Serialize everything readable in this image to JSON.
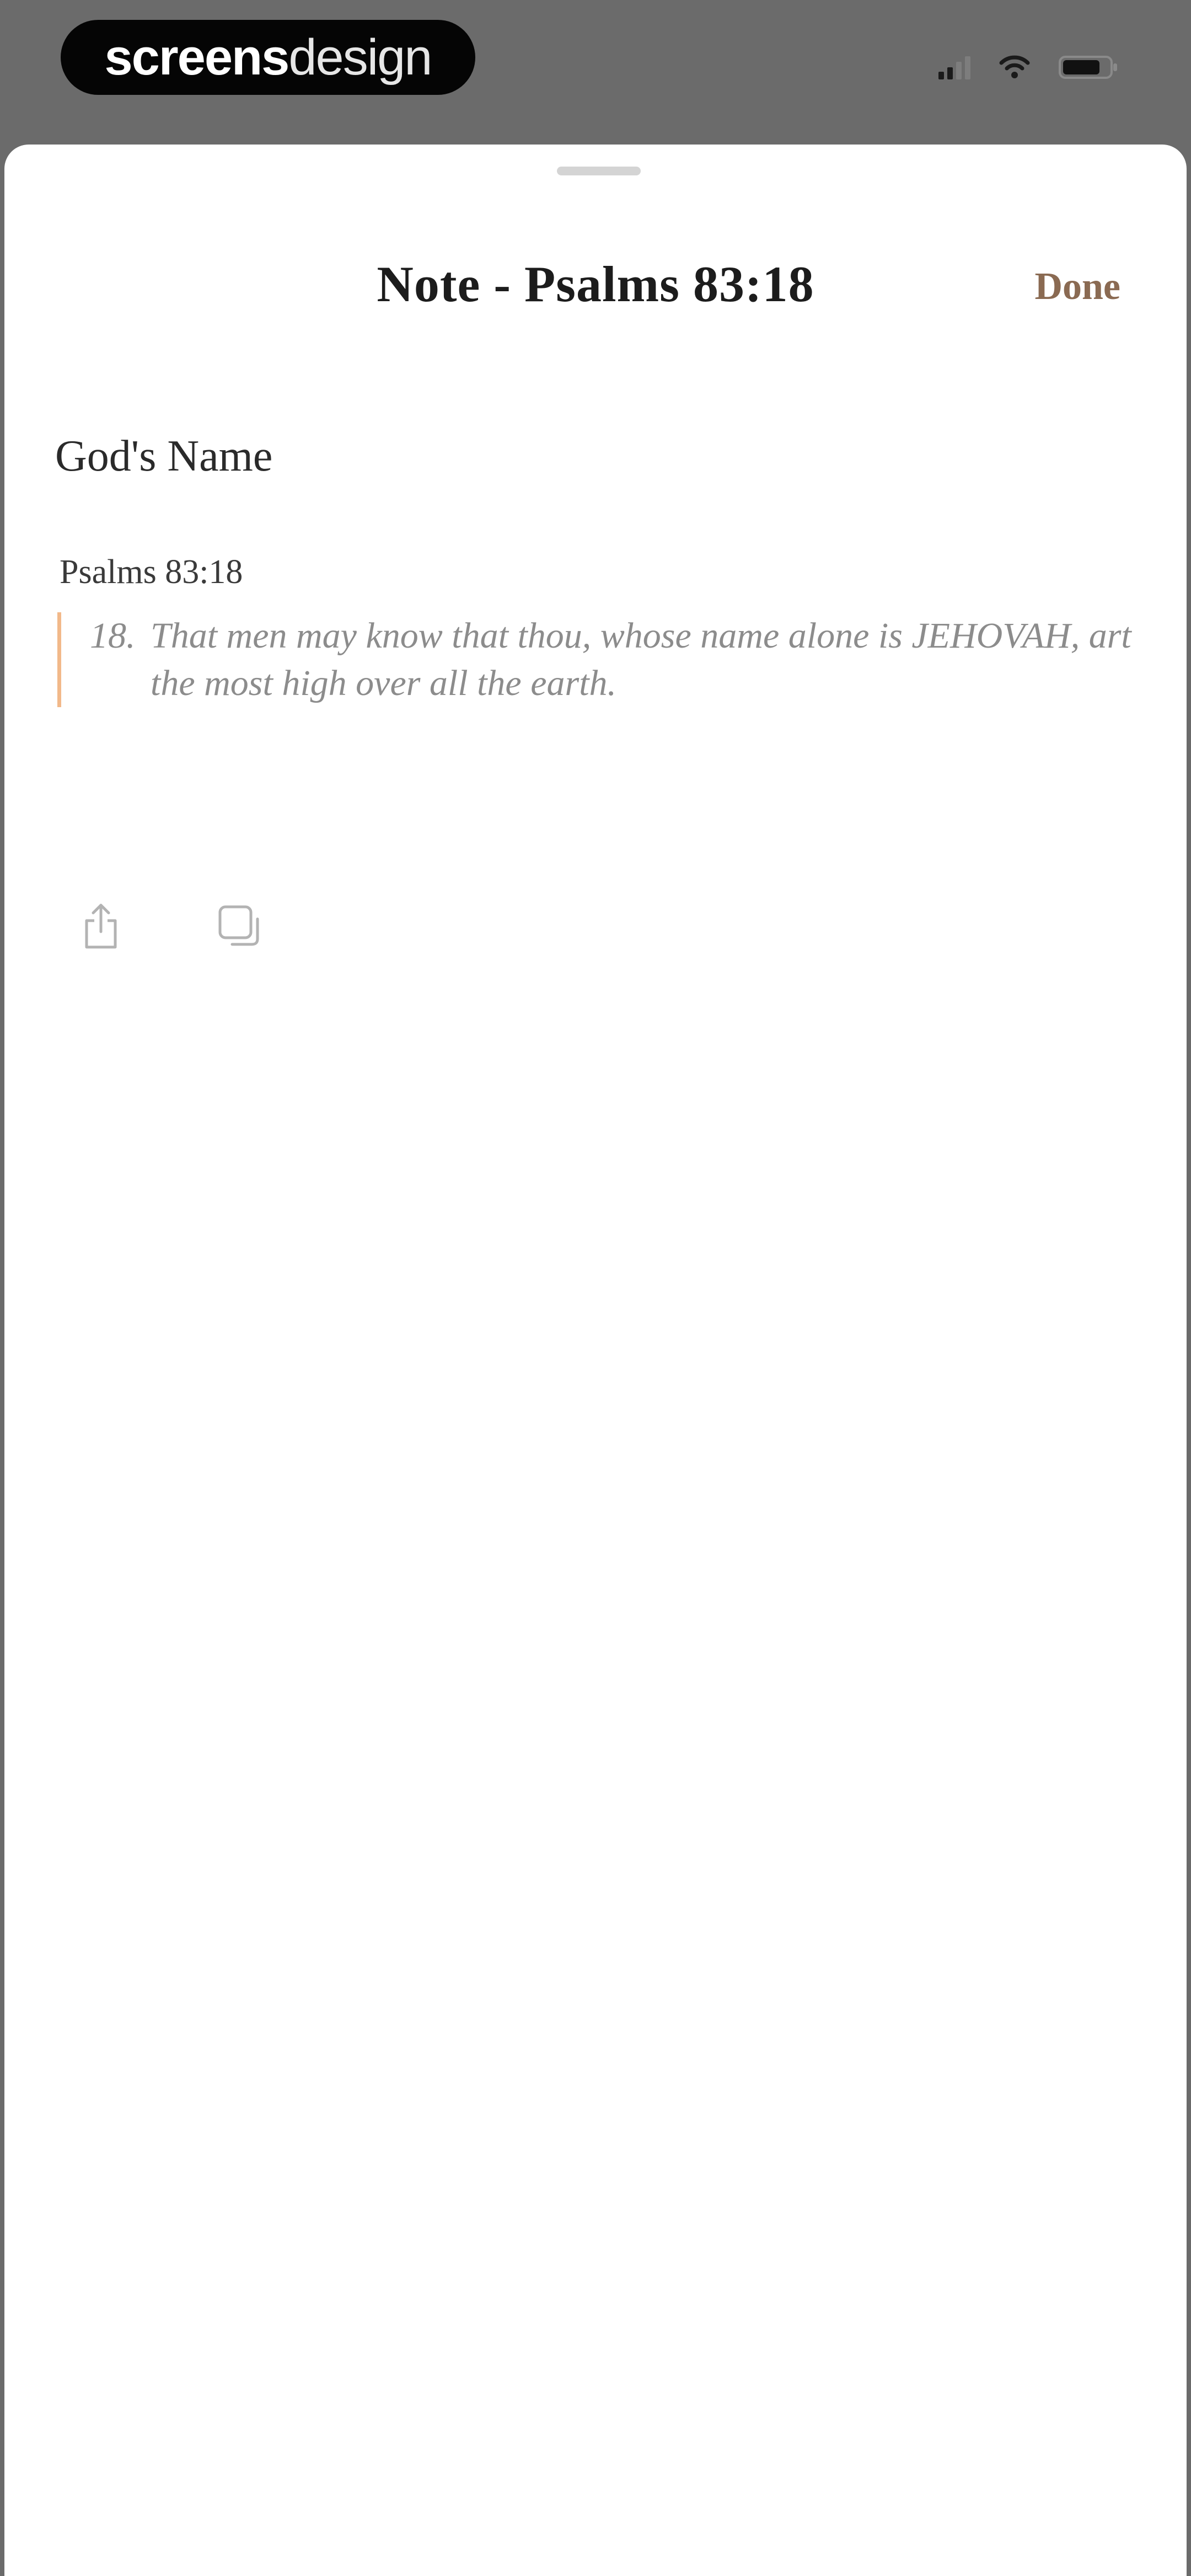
{
  "status_bar": {
    "brand_bold": "screens",
    "brand_light": "design"
  },
  "sheet": {
    "title": "Note - Psalms 83:18",
    "done_label": "Done"
  },
  "note": {
    "title": "God's Name",
    "reference": "Psalms 83:18",
    "verse_number": "18.",
    "verse_text": "That men may know that thou, whose name alone is JEHOVAH, art the most high over all the earth."
  },
  "actions": [
    {
      "icon": "share-icon"
    },
    {
      "icon": "copy-icon"
    }
  ],
  "colors": {
    "accent": "#8a6a52",
    "quote_bar": "#f2b98a",
    "backdrop": "#6b6b6b"
  }
}
